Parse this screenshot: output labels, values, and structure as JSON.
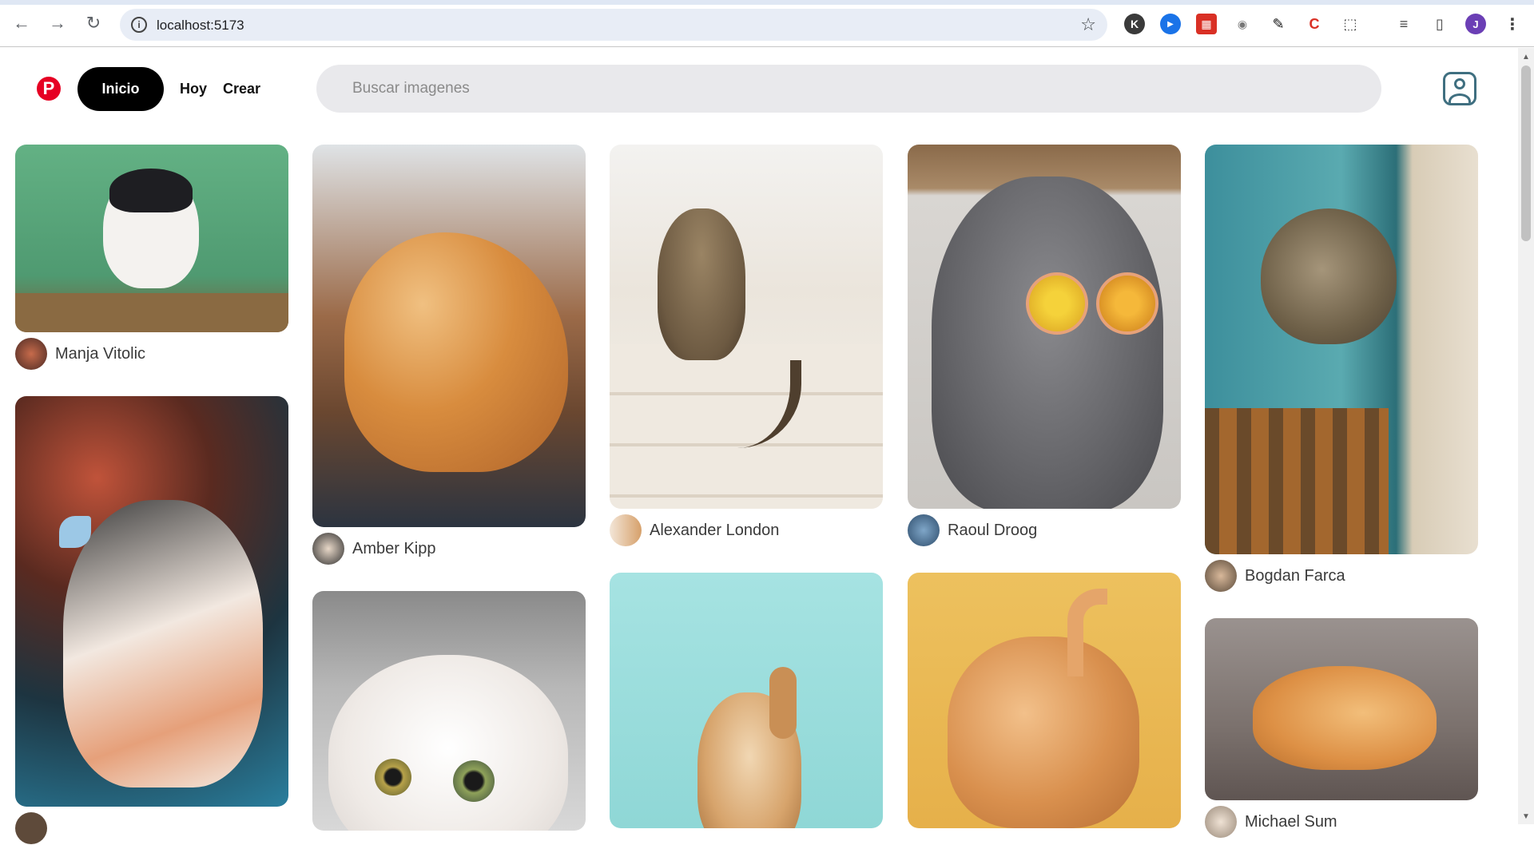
{
  "browser": {
    "url": "localhost:5173",
    "nav": {
      "back_icon": "←",
      "forward_icon": "→",
      "reload_icon": "↻"
    },
    "extensions": [
      "K",
      "▶",
      "▦",
      "◉",
      "✎",
      "C",
      "⬚",
      "≡",
      "▯",
      "J",
      "⋮"
    ]
  },
  "header": {
    "logo": "P",
    "inicio_label": "Inicio",
    "hoy_label": "Hoy",
    "crear_label": "Crear",
    "search_placeholder": "Buscar imagenes"
  },
  "pins": [
    {
      "author": "Manja Vitolic",
      "colors": [
        "#5fa77e",
        "#2f6a4c"
      ]
    },
    {
      "author": "Amber Kipp",
      "colors": [
        "#8a5a35",
        "#3b2a1e"
      ]
    },
    {
      "author": "Alexander London",
      "colors": [
        "#eeeae3",
        "#d8d0c4"
      ]
    },
    {
      "author": "Raoul Droog",
      "colors": [
        "#7b7b7e",
        "#4e4e52"
      ]
    },
    {
      "author": "Bogdan Farca",
      "colors": [
        "#3e8c9a",
        "#2a5d65"
      ]
    },
    {
      "author": "",
      "colors": [
        "#a3584a",
        "#1f3e4a"
      ]
    },
    {
      "author": "",
      "colors": [
        "#b0b0b0",
        "#8e8e8e"
      ]
    },
    {
      "author": "",
      "colors": [
        "#a8e4e2",
        "#7ccfd0"
      ]
    },
    {
      "author": "",
      "colors": [
        "#eab34f",
        "#d89a30"
      ]
    },
    {
      "author": "Michael Sum",
      "colors": [
        "#9a9290",
        "#6f6664"
      ]
    }
  ]
}
